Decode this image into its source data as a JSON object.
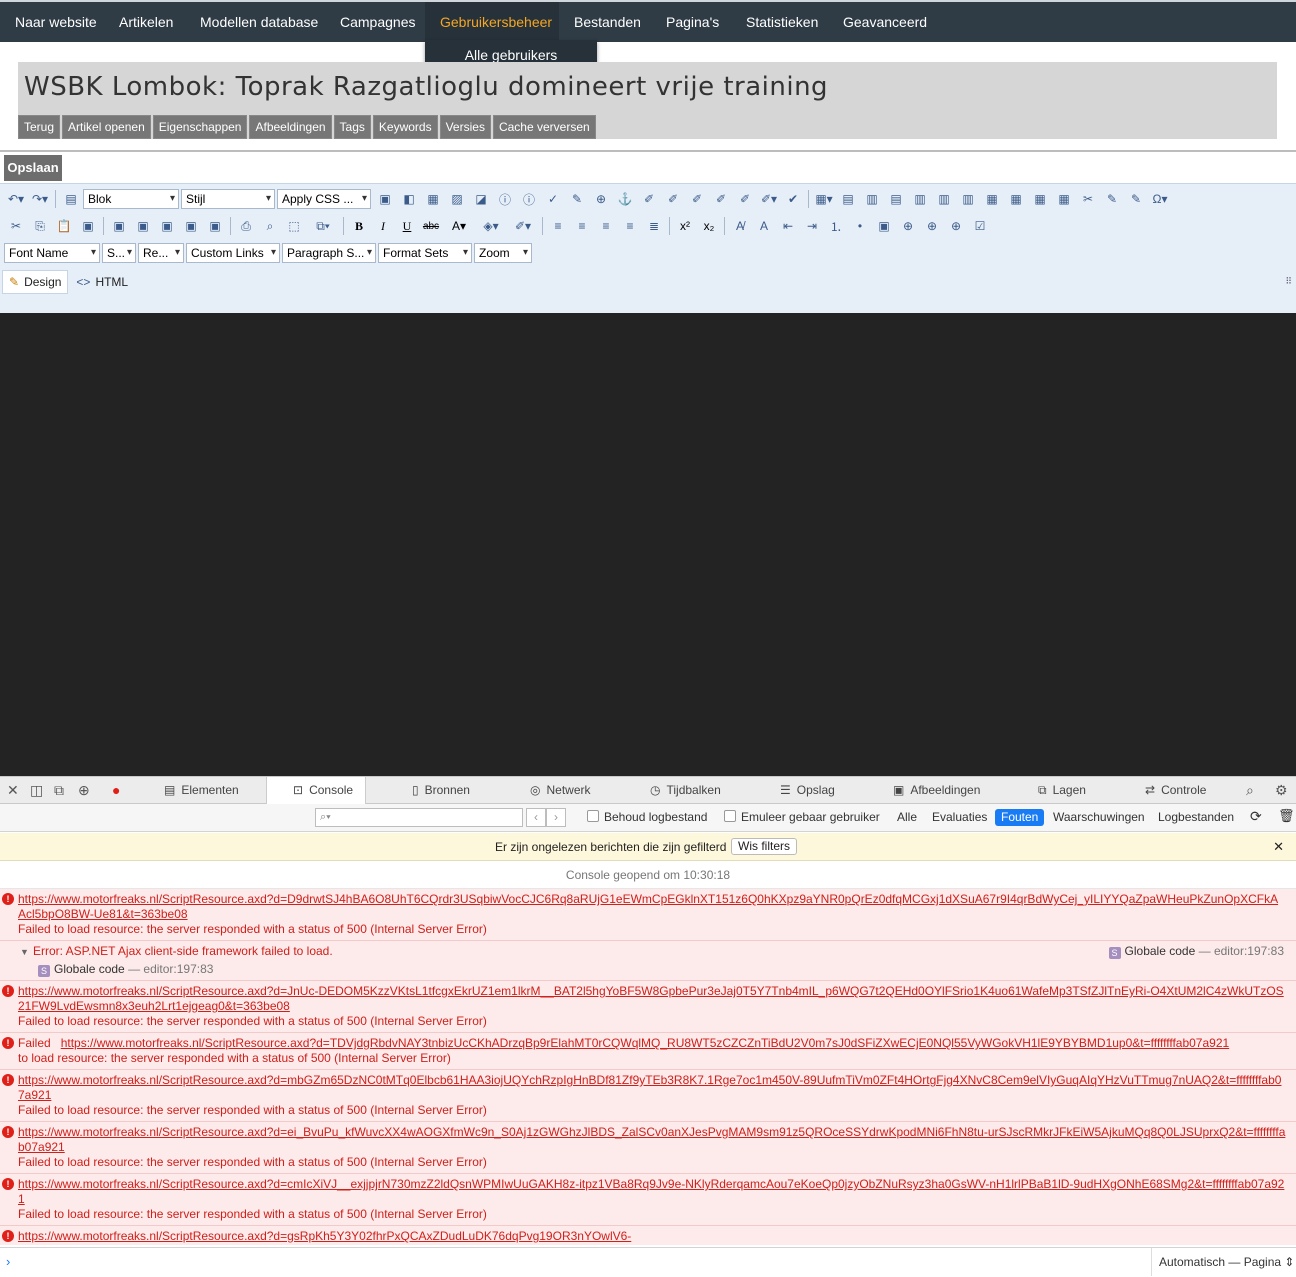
{
  "nav": {
    "items": [
      {
        "label": "Naar website"
      },
      {
        "label": "Artikelen"
      },
      {
        "label": "Modellen database"
      },
      {
        "label": "Campagnes"
      },
      {
        "label": "Gebruikersbeheer"
      },
      {
        "label": "Bestanden"
      },
      {
        "label": "Pagina's"
      },
      {
        "label": "Statistieken"
      },
      {
        "label": "Geavanceerd"
      }
    ],
    "active_index": 4,
    "active_color": "#f5a623",
    "dropdown_item": "Alle gebruikers"
  },
  "article": {
    "title": "WSBK Lombok: Toprak Razgatlioglu domineert vrije training",
    "tabs": [
      "Terug",
      "Artikel openen",
      "Eigenschappen",
      "Afbeeldingen",
      "Tags",
      "Keywords",
      "Versies",
      "Cache verversen"
    ]
  },
  "save_label": "Opslaan",
  "editor": {
    "combo_blok": "Blok",
    "combo_stijl": "Stijl",
    "combo_css": "Apply CSS ...",
    "combo_font": "Font Name",
    "combo_size": "S...",
    "combo_re": "Re...",
    "combo_links": "Custom Links",
    "combo_para": "Paragraph S...",
    "combo_format": "Format Sets",
    "combo_zoom": "Zoom",
    "mode_design": "Design",
    "mode_html": "HTML"
  },
  "devtools": {
    "tabs": [
      "Elementen",
      "Console",
      "Bronnen",
      "Netwerk",
      "Tijdbalken",
      "Opslag",
      "Afbeeldingen",
      "Lagen",
      "Controle"
    ],
    "active_tab": "Console",
    "preserve_log": "Behoud logbestand",
    "emulate_user": "Emuleer gebaar gebruiker",
    "filters": [
      "Alle",
      "Evaluaties",
      "Fouten",
      "Waarschuwingen",
      "Logbestanden"
    ],
    "active_filter": "Fouten",
    "notice": "Er zijn ongelezen berichten die zijn gefilterd",
    "clear_filters": "Wis filters",
    "opened_at": "Console geopend om 10:30:18",
    "context": "Automatisch — Pagina"
  },
  "messages": [
    {
      "url": "https://www.motorfreaks.nl/ScriptResource.axd?d=D9drwtSJ4hBA6O8UhT6CQrdr3USqbiwVocCJC6Rq8aRUjG1eEWmCpEGklnXT151z6Q0hKXpz9aYNR0pQrEz0dfqMCGxj1dXSuA67r9I4qrBdWyCej_yILIYYQaZpaWHeuPkZunOpXCFkAAcl5bpO8BW-Ue81&t=363be08",
      "text": "Failed to load resource: the server responded with a status of 500 (Internal Server Error)"
    },
    {
      "error": "Error: ASP.NET Ajax client-side framework failed to load.",
      "scope": "Globale code",
      "location": "editor:197:83"
    },
    {
      "url": "https://www.motorfreaks.nl/ScriptResource.axd?d=JnUc-DEDOM5KzzVKtsL1tfcgxEkrUZ1em1lkrM__BAT2l5hgYoBF5W8GpbePur3eJaj0T5Y7Tnb4mIL_p6WQG7t2QEHd0OYlFSrio1K4uo61WafeMp3TSfZJlTnEyRi-O4XtUM2lC4zWkUTzOS21FW9LvdEwsmn8x3euh2Lrt1ejgeag0&t=363be08",
      "text": "Failed to load resource: the server responded with a status of 500 (Internal Server Error)"
    },
    {
      "prefix": "Failed",
      "url": "https://www.motorfreaks.nl/ScriptResource.axd?d=TDVjdgRbdvNAY3tnbizUcCKhADrzqBp9rElahMT0rCQWqlMQ_RU8WT5zCZCZnTiBdU2V0m7sJ0dSFiZXwECjE0NQl55VyWGokVH1lE9YBYBMD1up0&t=ffffffffab07a921",
      "text": "to load resource: the server responded with a status of 500 (Internal Server Error)"
    },
    {
      "url": "https://www.motorfreaks.nl/ScriptResource.axd?d=mbGZm65DzNC0tMTq0Elbcb61HAA3iojUQYchRzpIgHnBDf81Zf9yTEb3R8K7.1Rge7oc1m450V-89UufmTiVm0ZFt4HOrtgFjg4XNvC8Cem9elVIyGuqAIqYHzVuTTmug7nUAQ2&t=ffffffffab07a921",
      "text": "Failed to load resource: the server responded with a status of 500 (Internal Server Error)"
    },
    {
      "url": "https://www.motorfreaks.nl/ScriptResource.axd?d=ei_BvuPu_kfWuvcXX4wAOGXfmWc9n_S0Aj1zGWGhzJlBDS_ZalSCv0anXJesPvgMAM9sm91z5QROceSSYdrwKpodMNi6FhN8tu-urSJscRMkrJFkEiW5AjkuMQq8Q0LJSUprxQ2&t=ffffffffab07a921",
      "text": "Failed to load resource: the server responded with a status of 500 (Internal Server Error)"
    },
    {
      "url": "https://www.motorfreaks.nl/ScriptResource.axd?d=cmIcXiVJ__exjjpjrN730mzZ2ldQsnWPMIwUuGAKH8z-itpz1VBa8Rq9Jv9e-NKlyRderqamcAou7eKoeQp0jzyObZNuRsyz3ha0GsWV-nH1lrlPBaB1lD-9udHXgONhE68SMg2&t=ffffffffab07a921",
      "text": "Failed to load resource: the server responded with a status of 500 (Internal Server Error)"
    },
    {
      "url": "https://www.motorfreaks.nl/ScriptResource.axd?d=gsRpKh5Y3Y02fhrPxQCAxZDudLuDK76dqPvg19OR3nYOwlV6-",
      "text": ""
    }
  ]
}
